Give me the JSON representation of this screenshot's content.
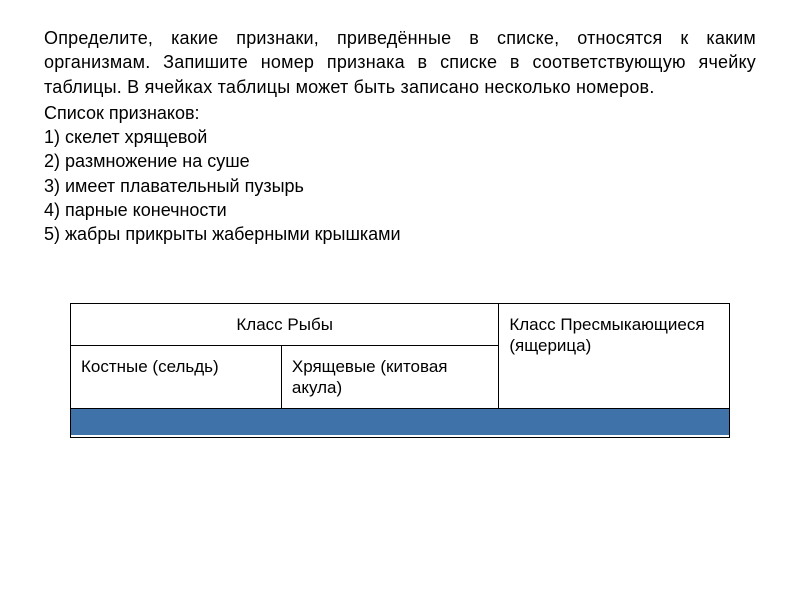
{
  "task": {
    "paragraph": "Определите, какие признаки, приведённые в списке, относятся к каким организмам. Запишите номер признака в списке в соответствующую ячейку таблицы. В ячейках таблицы может быть записано несколько номеров.",
    "list_heading": "Список признаков:",
    "features": [
      "1) скелет хрящевой",
      "2) размножение на суше",
      "3) имеет плавательный пузырь",
      "4) парные конечности",
      "5) жабры прикрыты жаберными крышками"
    ]
  },
  "table": {
    "fish_header": "Класс Рыбы",
    "reptiles_header": "Класс Пресмыкающиеся (ящерица)",
    "bony_label": "Костные (сельдь)",
    "cartilaginous_label": "Хрящевые (китовая акула)"
  }
}
